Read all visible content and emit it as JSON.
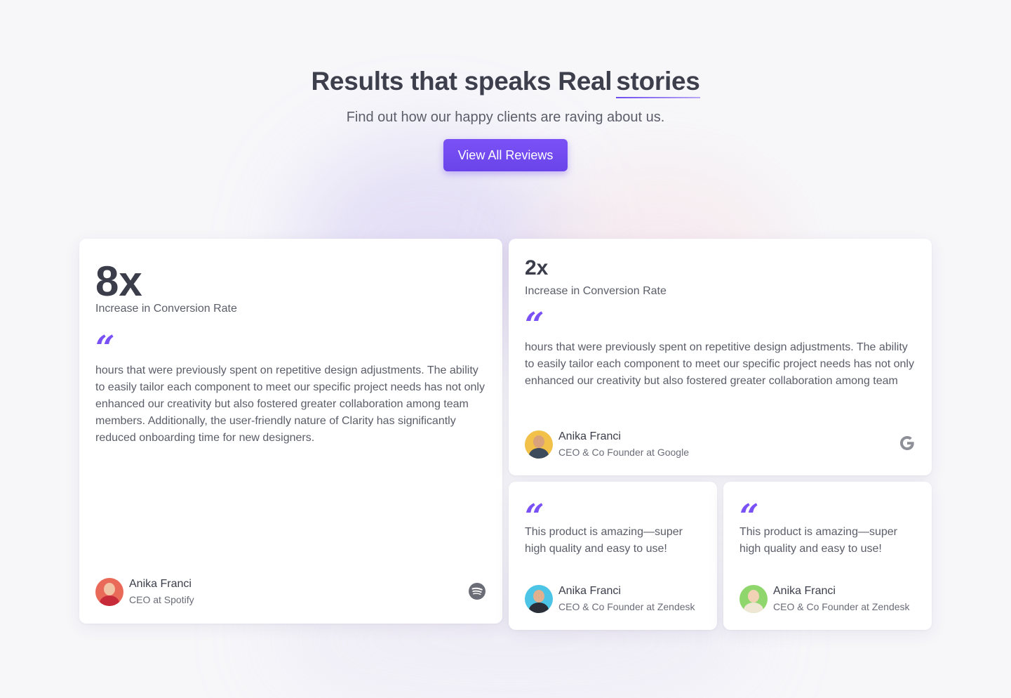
{
  "hero": {
    "title_main": "Results that speaks Real",
    "title_highlight": "stories",
    "subtitle": "Find out how our happy clients are raving about us.",
    "cta_label": "View All Reviews"
  },
  "colors": {
    "accent": "#7a51f5",
    "text_dark": "#3b3d4a",
    "text_muted": "#5b5d69"
  },
  "quote_glyph": "“",
  "cards": [
    {
      "stat": "8x",
      "stat_label": "Increase in Conversion Rate",
      "quote": "hours that were previously spent on repetitive design adjustments. The ability to easily tailor each component to meet our specific project needs has not only enhanced our creativity but also fostered greater collaboration among team members. Additionally, the user-friendly nature of Clarity has significantly reduced onboarding time for new designers.",
      "author_name": "Anika Franci",
      "author_role": "CEO at Spotify",
      "brand_icon": "spotify-icon"
    },
    {
      "stat": "2x",
      "stat_label": "Increase in Conversion Rate",
      "quote": "hours that were previously spent on repetitive design adjustments. The ability to easily tailor each component to meet our specific project needs has not only enhanced our creativity but also fostered greater collaboration among team",
      "author_name": "Anika Franci",
      "author_role": "CEO & Co Founder at Google",
      "brand_icon": "google-icon"
    },
    {
      "quote": "This product is amazing—super high quality and easy to use!",
      "author_name": "Anika Franci",
      "author_role": "CEO & Co Founder at Zendesk"
    },
    {
      "quote": "This product is amazing—super high quality and easy to use!",
      "author_name": "Anika Franci",
      "author_role": "CEO & Co Founder at Zendesk"
    }
  ]
}
